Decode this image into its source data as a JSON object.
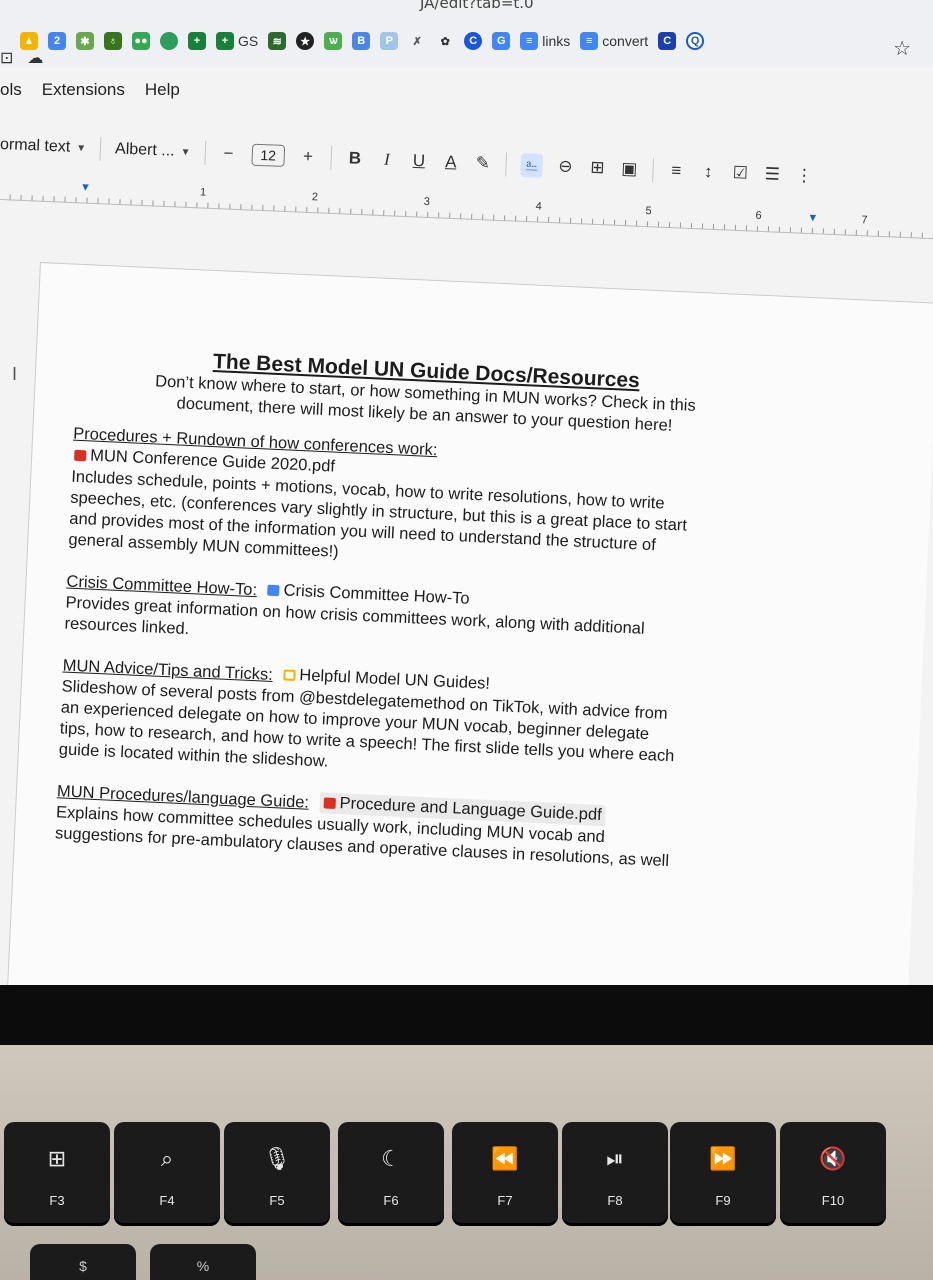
{
  "browser": {
    "url_fragment": "JA/edit?tab=t.0",
    "bookmarks": [
      {
        "icon": "drive-icon",
        "label": ""
      },
      {
        "icon": "calendar-icon",
        "label": ""
      },
      {
        "icon": "puzzle-icon",
        "label": ""
      },
      {
        "icon": "bag-icon",
        "label": ""
      },
      {
        "icon": "eyes-icon",
        "label": ""
      },
      {
        "icon": "leaf-icon",
        "label": ""
      },
      {
        "icon": "plus-icon",
        "label": ""
      },
      {
        "icon": "plus-icon",
        "label": "GS"
      },
      {
        "icon": "book-icon",
        "label": ""
      },
      {
        "icon": "star-badge-icon",
        "label": ""
      },
      {
        "icon": "frog-icon",
        "label": ""
      },
      {
        "icon": "b-icon",
        "label": ""
      },
      {
        "icon": "p-icon",
        "label": ""
      },
      {
        "icon": "x-icon",
        "label": ""
      },
      {
        "icon": "openai-icon",
        "label": ""
      },
      {
        "icon": "c-circle-icon",
        "label": ""
      },
      {
        "icon": "g-icon",
        "label": ""
      },
      {
        "icon": "docs-icon",
        "label": "links"
      },
      {
        "icon": "docs-icon",
        "label": "convert"
      },
      {
        "icon": "c-square-icon",
        "label": ""
      },
      {
        "icon": "q-icon",
        "label": ""
      }
    ]
  },
  "menu": {
    "items": [
      "ols",
      "Extensions",
      "Help"
    ]
  },
  "toolbar": {
    "style": "ormal text",
    "font": "Albert ...",
    "minus": "−",
    "font_size": "12",
    "plus": "+",
    "bold": "B",
    "italic": "I",
    "underline": "U",
    "text_color": "A"
  },
  "ruler": {
    "numbers": [
      "1",
      "2",
      "3",
      "4",
      "5",
      "6",
      "7"
    ]
  },
  "document": {
    "title": "The Best Model UN Guide Docs/Resources",
    "intro_1": "Don’t know where to start, or how something in MUN works? Check in this",
    "intro_2": "document, there will most likely be an answer to your question here!",
    "sections": [
      {
        "heading": "Procedures + Rundown of how conferences work:",
        "chip": "MUN Conference Guide 2020.pdf",
        "chip_color": "#d93025",
        "body": [
          "Includes schedule, points + motions, vocab, how to write resolutions, how to write",
          "speeches, etc. (conferences vary slightly in structure, but this is a great place to start",
          "and provides most of the information you will need to understand the structure of",
          "general assembly MUN committees!)"
        ]
      },
      {
        "heading": "Crisis Committee How-To:",
        "chip": "Crisis Committee How-To",
        "chip_color": "#4285f4",
        "body": [
          "Provides great information on how crisis committees work, along with additional",
          "resources linked."
        ]
      },
      {
        "heading": "MUN Advice/Tips and Tricks:",
        "chip": "Helpful Model UN Guides!",
        "chip_color": "#f4b400",
        "body": [
          "Slideshow of several posts from @bestdelegatemethod on TikTok, with advice from",
          "an experienced delegate on how to improve your MUN vocab, beginner delegate",
          "tips, how to research, and how to write a speech! The first slide tells you where each",
          "guide is located within the slideshow."
        ]
      },
      {
        "heading": "MUN Procedures/language Guide:",
        "chip": "Procedure and Language Guide.pdf",
        "chip_color": "#d93025",
        "body": [
          "Explains how committee schedules usually work, including MUN vocab and",
          "suggestions for pre-ambulatory clauses and operative clauses in resolutions, as well"
        ]
      }
    ]
  },
  "keyboard": {
    "keys": [
      {
        "label": "F3",
        "glyph": "⊞"
      },
      {
        "label": "F4",
        "glyph": "⌕"
      },
      {
        "label": "F5",
        "glyph": "🎙"
      },
      {
        "label": "F6",
        "glyph": "☾"
      },
      {
        "label": "F7",
        "glyph": "⏪"
      },
      {
        "label": "F8",
        "glyph": "⏯"
      },
      {
        "label": "F9",
        "glyph": "⏩"
      },
      {
        "label": "F10",
        "glyph": "🔇"
      }
    ],
    "row2": [
      "$",
      "%"
    ]
  }
}
